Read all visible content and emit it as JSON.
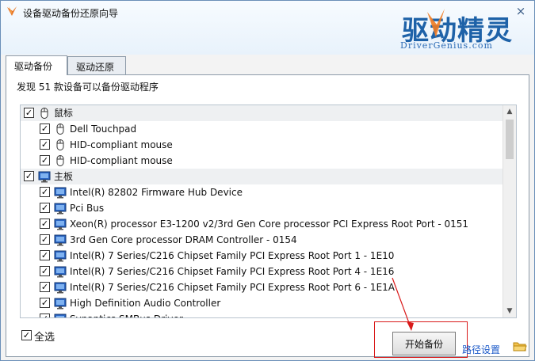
{
  "window": {
    "title": "设备驱动备份还原向导",
    "close_glyph": "×",
    "accent": "#1e62a8"
  },
  "logo": {
    "main": "驱动精灵",
    "sub": "DriverGenius.com"
  },
  "tabs": [
    {
      "label": "驱动备份",
      "active": true
    },
    {
      "label": "驱动还原",
      "active": false
    }
  ],
  "found_text": "发现 51 款设备可以备份驱动程序",
  "check_glyph": "✓",
  "groups": [
    {
      "label": "鼠标",
      "icon": "mouse-icon",
      "checked": true,
      "items": [
        {
          "label": "Dell Touchpad",
          "checked": true
        },
        {
          "label": "HID-compliant mouse",
          "checked": true
        },
        {
          "label": "HID-compliant mouse",
          "checked": true
        }
      ]
    },
    {
      "label": "主板",
      "icon": "monitor-icon",
      "checked": true,
      "items": [
        {
          "label": "Intel(R) 82802 Firmware Hub Device",
          "checked": true
        },
        {
          "label": "Pci Bus",
          "checked": true
        },
        {
          "label": "Xeon(R) processor E3-1200 v2/3rd Gen Core processor PCI Express Root Port - 0151",
          "checked": true
        },
        {
          "label": "3rd Gen Core processor DRAM Controller - 0154",
          "checked": true
        },
        {
          "label": "Intel(R) 7 Series/C216 Chipset Family PCI Express Root Port 1 - 1E10",
          "checked": true
        },
        {
          "label": "Intel(R) 7 Series/C216 Chipset Family PCI Express Root Port 4 - 1E16",
          "checked": true
        },
        {
          "label": "Intel(R) 7 Series/C216 Chipset Family PCI Express Root Port 6 - 1E1A",
          "checked": true
        },
        {
          "label": "High Definition Audio Controller",
          "checked": true
        },
        {
          "label": "Synaptics SMBus Driver",
          "checked": true
        }
      ]
    }
  ],
  "scroll": {
    "up": "▲",
    "down": "▼"
  },
  "select_all": {
    "label": "全选",
    "checked": true
  },
  "start_button": "开始备份",
  "path_settings": "路径设置",
  "highlight_color": "#d91a1a"
}
